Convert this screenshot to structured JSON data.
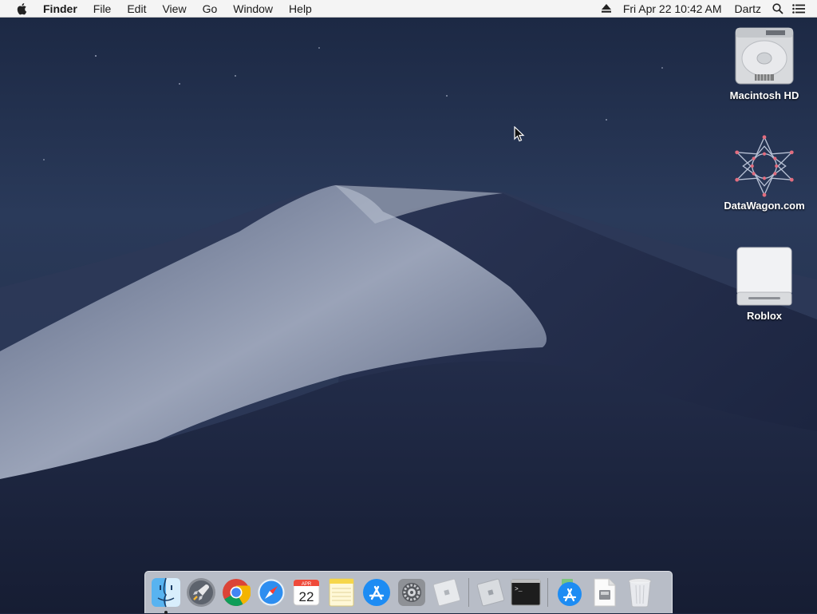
{
  "menubar": {
    "app_name": "Finder",
    "menus": [
      "File",
      "Edit",
      "View",
      "Go",
      "Window",
      "Help"
    ],
    "datetime": "Fri Apr 22  10:42 AM",
    "user": "Dartz",
    "icons": [
      "apple-icon",
      "eject-icon",
      "spotlight-search-icon",
      "notification-center-icon"
    ]
  },
  "desktop": {
    "icons": [
      {
        "label": "Macintosh HD",
        "icon": "hard-drive-icon"
      },
      {
        "label": "DataWagon.com",
        "icon": "network-server-icon"
      },
      {
        "label": "Roblox",
        "icon": "external-drive-icon"
      }
    ]
  },
  "dock": {
    "items": [
      {
        "name": "Finder",
        "icon": "finder-icon",
        "running": true
      },
      {
        "name": "Launchpad",
        "icon": "launchpad-rocket-icon"
      },
      {
        "name": "Google Chrome",
        "icon": "chrome-icon"
      },
      {
        "name": "Safari",
        "icon": "safari-compass-icon"
      },
      {
        "name": "Calendar",
        "icon": "calendar-icon",
        "month": "APR",
        "day": "22"
      },
      {
        "name": "Notes",
        "icon": "notes-icon"
      },
      {
        "name": "App Store",
        "icon": "app-store-icon"
      },
      {
        "name": "System Preferences",
        "icon": "gear-icon"
      },
      {
        "name": "Roblox",
        "icon": "roblox-icon"
      },
      {
        "name": "Roblox Studio",
        "icon": "roblox-studio-icon"
      },
      {
        "name": "Terminal",
        "icon": "terminal-icon",
        "prompt": ">_"
      },
      {
        "name": "Downloads",
        "icon": "app-store-stack-icon"
      },
      {
        "name": "Document",
        "icon": "document-icon"
      },
      {
        "name": "Trash",
        "icon": "trash-icon"
      }
    ]
  },
  "colors": {
    "menubar_bg": "#f4f4f4",
    "wallpaper_sky": "#1f2a44",
    "dune_light": "#8e97ad",
    "dune_dark": "#1a2340"
  }
}
